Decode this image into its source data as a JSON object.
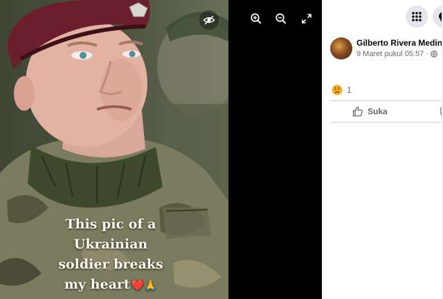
{
  "viewer": {
    "caption_lines": [
      "This pic of a",
      "Ukrainian",
      "soldier breaks",
      "my heart"
    ],
    "caption_emoji": {
      "heart": "❤️",
      "hands": "🙏"
    },
    "controls": {
      "hide": "eye-slash-icon",
      "zoom_in": "zoom-in-icon",
      "zoom_out": "zoom-out-icon",
      "fullscreen": "expand-icon"
    }
  },
  "top_right": {
    "menu_icon": "grid-menu-icon",
    "account_icon": "messenger-icon"
  },
  "post": {
    "author": "Gilberto Rivera Medina",
    "date": "9 Maret pukul 05.57",
    "date_separator": "·",
    "audience_icon": "globe-icon",
    "reaction_icon": "sad-face-icon",
    "reaction_count": "1",
    "like_label": "Suka"
  },
  "colors": {
    "panel_bg": "#ffffff",
    "viewer_bg": "#000000",
    "text_primary": "#050505",
    "text_secondary": "#65676b",
    "divider": "#ced0d4",
    "button_bg": "#e4e6eb"
  }
}
